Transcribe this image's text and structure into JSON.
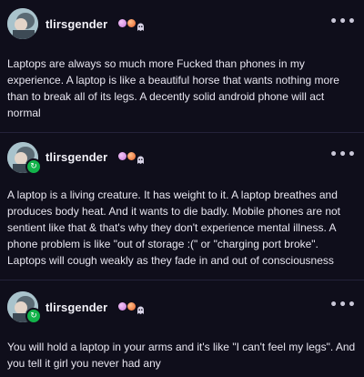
{
  "posts": [
    {
      "username": "tlirsgender",
      "more_label": "•••",
      "reblogged": false,
      "body": "Laptops are always so much more Fucked than phones in my experience. A laptop is like a beautiful horse that wants nothing more than to break all of its legs. A decently solid android phone will act normal"
    },
    {
      "username": "tlirsgender",
      "more_label": "•••",
      "reblogged": true,
      "body": "A laptop is a living creature. It has weight to it. A laptop breathes and produces body heat. And it wants to die badly. Mobile phones are not sentient like that & that's why they don't experience mental illness. A phone problem is like \"out of storage :(\" or \"charging port broke\". Laptops will cough weakly as they fade in and out of consciousness"
    },
    {
      "username": "tlirsgender",
      "more_label": "•••",
      "reblogged": true,
      "body": "You will hold a laptop in your arms and it's like \"I can't feel my legs\". And you tell it girl you never had any"
    }
  ],
  "reblog_icon": "↻",
  "colors": {
    "background": "#0f0e1b",
    "text": "#e8e6f0",
    "reblog_badge": "#12b34a"
  },
  "icons": [
    "avatar",
    "pink-badge-icon",
    "orange-badge-icon",
    "ghost-badge-icon",
    "more-options-icon",
    "reblog-icon"
  ]
}
